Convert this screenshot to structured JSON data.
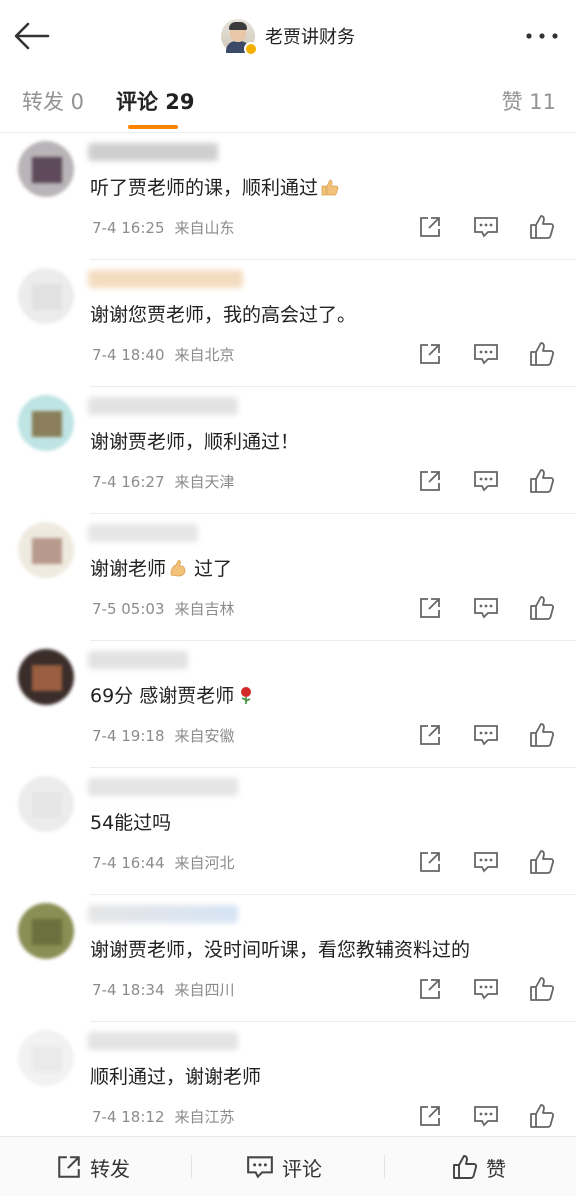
{
  "header": {
    "title": "老贾讲财务",
    "back_icon": "arrow-left-icon",
    "more_icon": "more-dots-icon"
  },
  "tabs": {
    "repost": "转发 0",
    "comments": "评论 29",
    "likes": "赞 11",
    "accent": "#ff8200"
  },
  "comments": [
    {
      "text": "听了贾老师的课，顺利通过",
      "emoji": "thumbs-up-emoji",
      "time": "7-4 16:25",
      "location": "来自山东"
    },
    {
      "text": "谢谢您贾老师，我的高会过了。",
      "time": "7-4 18:40",
      "location": "来自北京"
    },
    {
      "text": "谢谢贾老师，顺利通过！",
      "time": "7-4 16:27",
      "location": "来自天津"
    },
    {
      "text": "谢谢老师",
      "text_after": " 过了",
      "emoji": "muscle-emoji",
      "time": "7-5 05:03",
      "location": "来自吉林"
    },
    {
      "text": "69分 感谢贾老师",
      "emoji": "rose-emoji",
      "time": "7-4 19:18",
      "location": "来自安徽"
    },
    {
      "text": "54能过吗",
      "time": "7-4 16:44",
      "location": "来自河北"
    },
    {
      "text": "谢谢贾老师，没时间听课，看您教辅资料过的",
      "time": "7-4 18:34",
      "location": "来自四川"
    },
    {
      "text": "顺利通过，谢谢老师",
      "time": "7-4 18:12",
      "location": "来自江苏"
    }
  ],
  "bottom_bar": {
    "repost": "转发",
    "comment": "评论",
    "like": "赞"
  }
}
